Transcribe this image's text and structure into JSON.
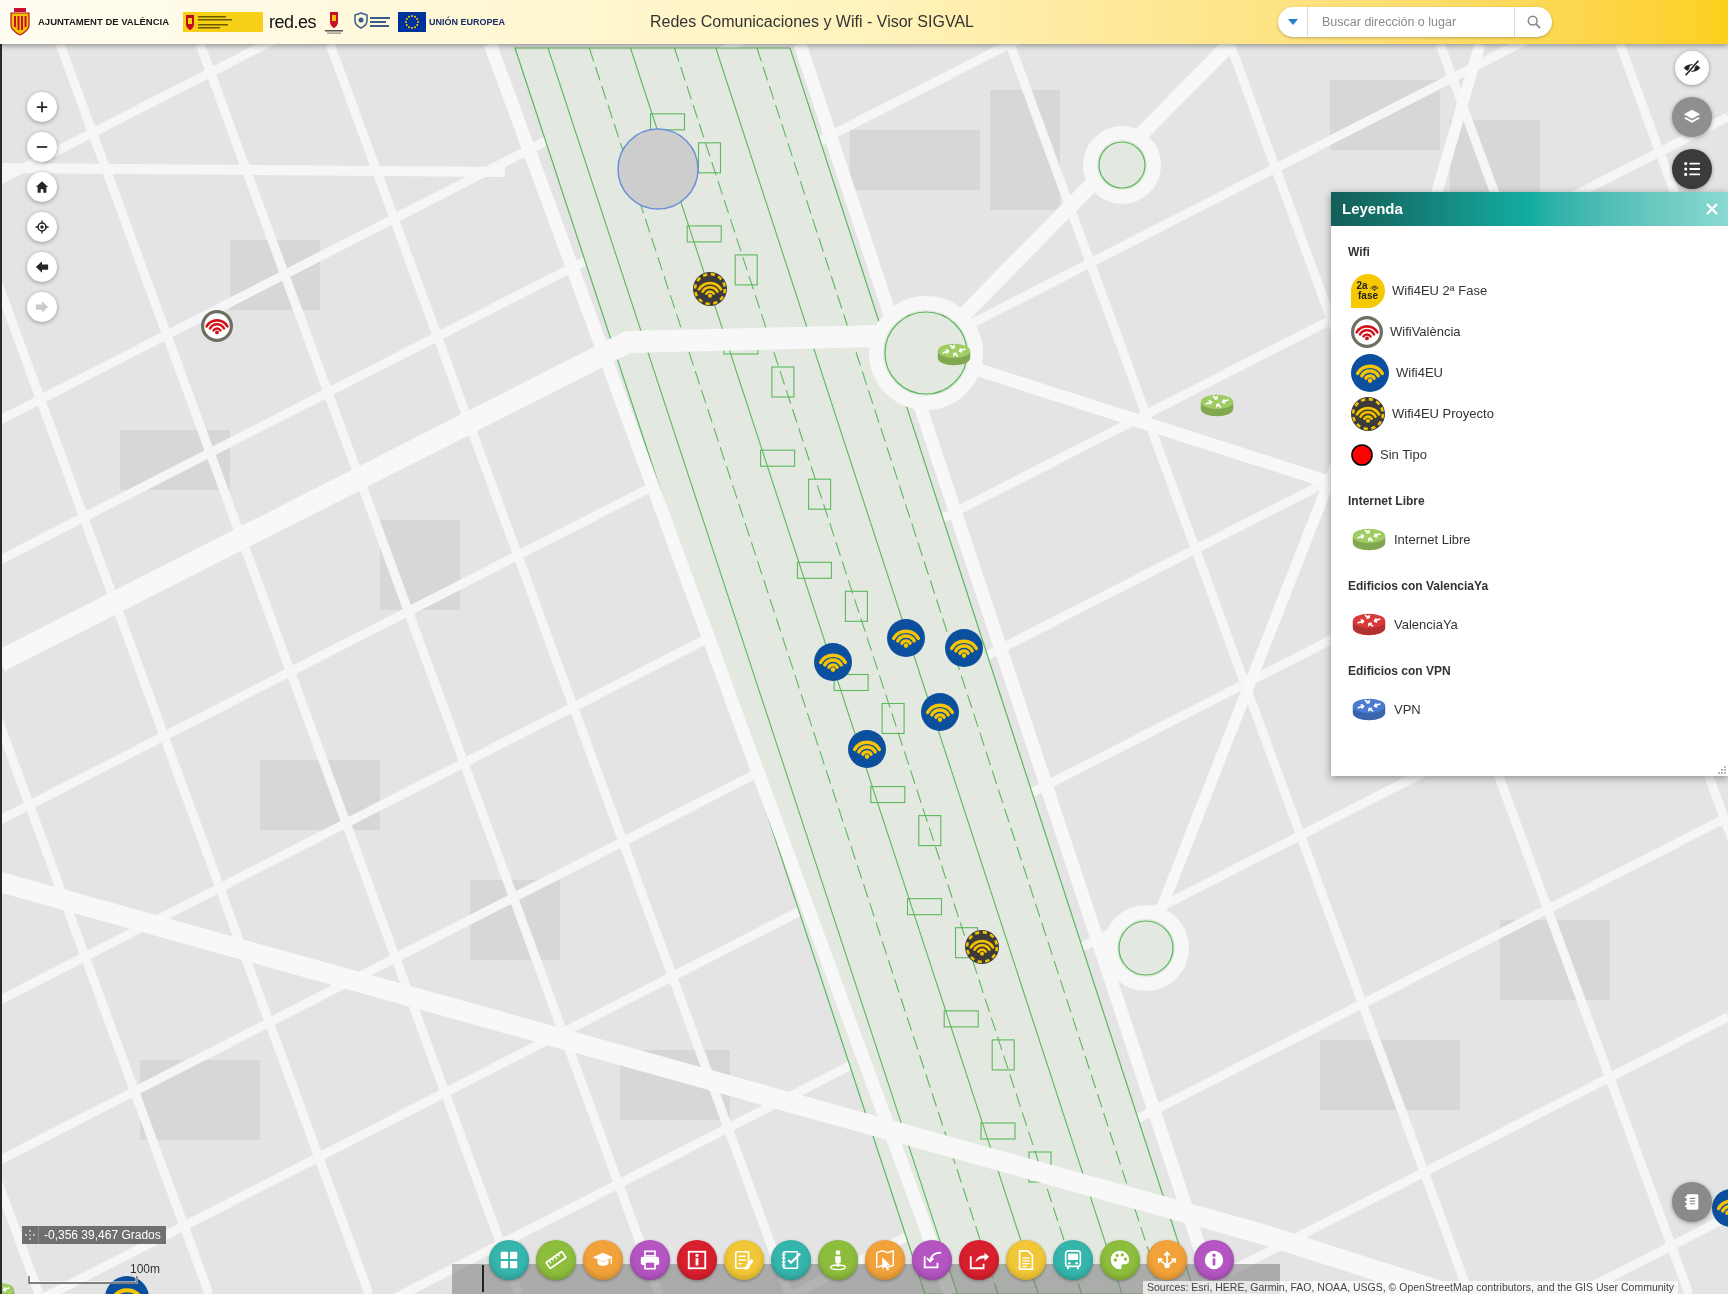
{
  "header": {
    "organization": "AJUNTAMENT DE VALÈNCIA",
    "partner_logos": [
      {
        "kind": "government"
      },
      {
        "kind": "wordmark",
        "text": "red.es"
      },
      {
        "kind": "city"
      },
      {
        "kind": "smart-cities"
      },
      {
        "kind": "eu",
        "text": "UNIÓN EUROPEA"
      }
    ],
    "title": "Redes Comunicaciones y Wifi - Visor SIGVAL",
    "search": {
      "placeholder": "Buscar dirección o lugar"
    }
  },
  "map_controls": [
    {
      "kind": "zoom-in",
      "disabled": false
    },
    {
      "kind": "zoom-out",
      "disabled": false
    },
    {
      "kind": "home",
      "disabled": false
    },
    {
      "kind": "locate",
      "disabled": false
    },
    {
      "kind": "back",
      "disabled": false
    },
    {
      "kind": "forward",
      "disabled": true
    }
  ],
  "side_tools": [
    {
      "kind": "hide"
    },
    {
      "kind": "layers"
    },
    {
      "kind": "legend"
    }
  ],
  "legend": {
    "title": "Leyenda",
    "sections": [
      {
        "heading": "Wifi",
        "items": [
          {
            "kind": "wifi4eu-2fase",
            "label": "Wifi4EU 2ª Fase",
            "badge": [
              "2a",
              "fase"
            ]
          },
          {
            "kind": "wifivalencia",
            "label": "WifiValència"
          },
          {
            "kind": "wifi4eu",
            "label": "Wifi4EU"
          },
          {
            "kind": "wifi4eu-proyecto",
            "label": "Wifi4EU Proyecto"
          },
          {
            "kind": "sin-tipo",
            "label": "Sin Tipo"
          }
        ]
      },
      {
        "heading": "Internet Libre",
        "items": [
          {
            "kind": "router",
            "color": "#9fcc63",
            "label": "Internet Libre"
          }
        ]
      },
      {
        "heading": "Edificios con ValenciaYa",
        "items": [
          {
            "kind": "router",
            "color": "#d93b3b",
            "label": "ValenciaYa"
          }
        ]
      },
      {
        "heading": "Edificios con VPN",
        "items": [
          {
            "kind": "router",
            "color": "#4a7bd0",
            "label": "VPN"
          }
        ]
      }
    ]
  },
  "map_markers": [
    {
      "kind": "wifi4eu-proyecto"
    },
    {
      "kind": "wifivalencia"
    },
    {
      "kind": "router",
      "color": "#9fcc63"
    },
    {
      "kind": "router",
      "color": "#9fcc63"
    },
    {
      "kind": "wifi4eu"
    },
    {
      "kind": "wifi4eu"
    },
    {
      "kind": "wifi4eu"
    },
    {
      "kind": "wifi4eu"
    },
    {
      "kind": "wifi4eu"
    },
    {
      "kind": "wifi4eu-proyecto"
    },
    {
      "kind": "wifi4eu"
    },
    {
      "kind": "router",
      "color": "#9fcc63"
    },
    {
      "kind": "wifi4eu"
    }
  ],
  "corner_button": {
    "kind": "notebook"
  },
  "coordinates": {
    "text": "-0,356 39,467 Grados"
  },
  "scale_bar": {
    "label": "100m"
  },
  "toolbar": [
    {
      "kind": "grid",
      "color": "#36b5ad"
    },
    {
      "kind": "ruler",
      "color": "#8dbd3c"
    },
    {
      "kind": "cap",
      "color": "#f2a23a"
    },
    {
      "kind": "printer",
      "color": "#b455c2"
    },
    {
      "kind": "info-box",
      "color": "#d81f2d"
    },
    {
      "kind": "notepad",
      "color": "#f1c737"
    },
    {
      "kind": "checklist",
      "color": "#36b5ad"
    },
    {
      "kind": "person",
      "color": "#8dbd3c"
    },
    {
      "kind": "map-pointer",
      "color": "#f2a23a"
    },
    {
      "kind": "share-in",
      "color": "#b455c2"
    },
    {
      "kind": "share-out",
      "color": "#d81f2d"
    },
    {
      "kind": "document",
      "color": "#f1c737"
    },
    {
      "kind": "bus",
      "color": "#36b5ad"
    },
    {
      "kind": "palette",
      "color": "#8dbd3c"
    },
    {
      "kind": "network",
      "color": "#f2a23a"
    },
    {
      "kind": "info",
      "color": "#b455c2"
    }
  ],
  "attribution": "Sources: Esri, HERE, Garmin, FAO, NOAA, USGS, © OpenStreetMap contributors, and the GIS User Community"
}
